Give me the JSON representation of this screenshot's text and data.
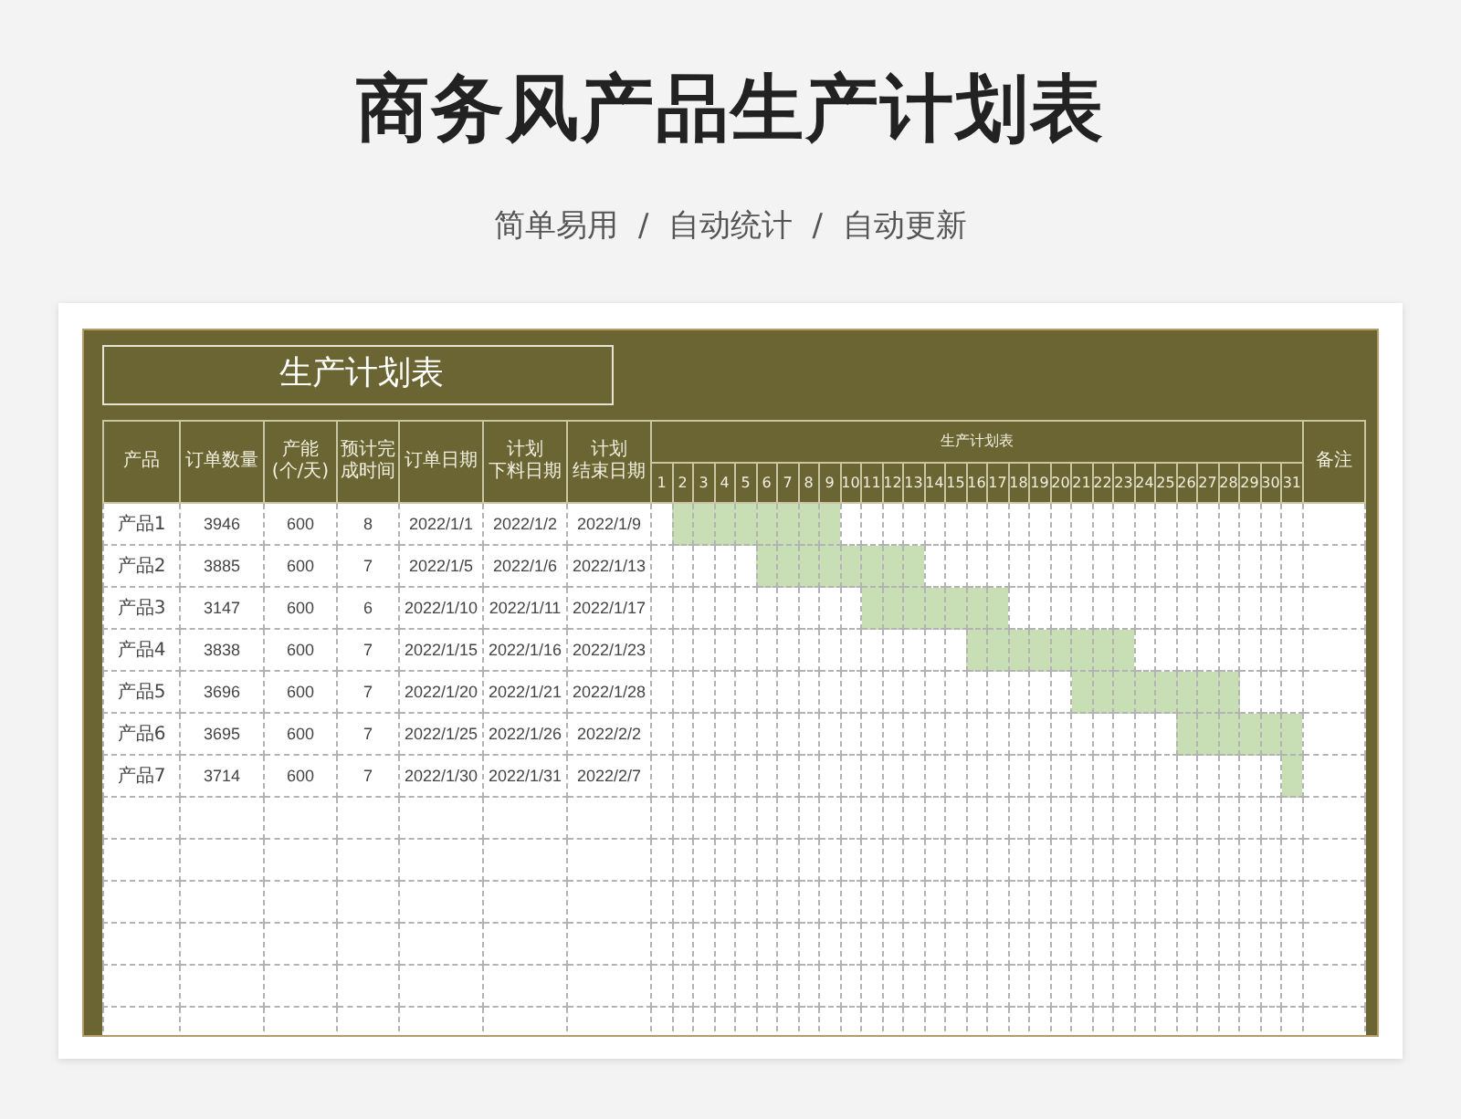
{
  "title": "商务风产品生产计划表",
  "subtitle": "简单易用  /  自动统计  /  自动更新",
  "sheet": {
    "title": "生产计划表",
    "columns": [
      {
        "label": "产品"
      },
      {
        "label": "订单数量"
      },
      {
        "label": "产能",
        "sublabel": "(个/天)"
      },
      {
        "label": "预计完成时间"
      },
      {
        "label": "订单日期"
      },
      {
        "label": "计划",
        "sublabel": "下料日期"
      },
      {
        "label": "计划",
        "sublabel": "结束日期"
      }
    ],
    "gantt_header": "生产计划表",
    "days": [
      "1",
      "2",
      "3",
      "4",
      "5",
      "6",
      "7",
      "8",
      "9",
      "10",
      "11",
      "12",
      "13",
      "14",
      "15",
      "16",
      "17",
      "18",
      "19",
      "20",
      "21",
      "22",
      "23",
      "24",
      "25",
      "26",
      "27",
      "28",
      "29",
      "30",
      "31"
    ],
    "notes_header": "备注",
    "rows": [
      {
        "cells": [
          "产品1",
          "3946",
          "600",
          "8",
          "2022/1/1",
          "2022/1/2",
          "2022/1/9"
        ],
        "gantt": [
          false,
          true,
          true,
          true,
          true,
          true,
          true,
          true,
          true,
          false,
          false,
          false,
          false,
          false,
          false,
          false,
          false,
          false,
          false,
          false,
          false,
          false,
          false,
          false,
          false,
          false,
          false,
          false,
          false,
          false,
          false
        ]
      },
      {
        "cells": [
          "产品2",
          "3885",
          "600",
          "7",
          "2022/1/5",
          "2022/1/6",
          "2022/1/13"
        ],
        "gantt": [
          false,
          false,
          false,
          false,
          false,
          true,
          true,
          true,
          true,
          true,
          true,
          true,
          true,
          false,
          false,
          false,
          false,
          false,
          false,
          false,
          false,
          false,
          false,
          false,
          false,
          false,
          false,
          false,
          false,
          false,
          false
        ]
      },
      {
        "cells": [
          "产品3",
          "3147",
          "600",
          "6",
          "2022/1/10",
          "2022/1/11",
          "2022/1/17"
        ],
        "gantt": [
          false,
          false,
          false,
          false,
          false,
          false,
          false,
          false,
          false,
          false,
          true,
          true,
          true,
          true,
          true,
          true,
          true,
          false,
          false,
          false,
          false,
          false,
          false,
          false,
          false,
          false,
          false,
          false,
          false,
          false,
          false
        ]
      },
      {
        "cells": [
          "产品4",
          "3838",
          "600",
          "7",
          "2022/1/15",
          "2022/1/16",
          "2022/1/23"
        ],
        "gantt": [
          false,
          false,
          false,
          false,
          false,
          false,
          false,
          false,
          false,
          false,
          false,
          false,
          false,
          false,
          false,
          true,
          true,
          true,
          true,
          true,
          true,
          true,
          true,
          false,
          false,
          false,
          false,
          false,
          false,
          false,
          false
        ]
      },
      {
        "cells": [
          "产品5",
          "3696",
          "600",
          "7",
          "2022/1/20",
          "2022/1/21",
          "2022/1/28"
        ],
        "gantt": [
          false,
          false,
          false,
          false,
          false,
          false,
          false,
          false,
          false,
          false,
          false,
          false,
          false,
          false,
          false,
          false,
          false,
          false,
          false,
          false,
          true,
          true,
          true,
          true,
          true,
          true,
          true,
          true,
          false,
          false,
          false
        ]
      },
      {
        "cells": [
          "产品6",
          "3695",
          "600",
          "7",
          "2022/1/25",
          "2022/1/26",
          "2022/2/2"
        ],
        "gantt": [
          false,
          false,
          false,
          false,
          false,
          false,
          false,
          false,
          false,
          false,
          false,
          false,
          false,
          false,
          false,
          false,
          false,
          false,
          false,
          false,
          false,
          false,
          false,
          false,
          false,
          true,
          true,
          true,
          true,
          true,
          true
        ]
      },
      {
        "cells": [
          "产品7",
          "3714",
          "600",
          "7",
          "2022/1/30",
          "2022/1/31",
          "2022/2/7"
        ],
        "gantt": [
          false,
          false,
          false,
          false,
          false,
          false,
          false,
          false,
          false,
          false,
          false,
          false,
          false,
          false,
          false,
          false,
          false,
          false,
          false,
          false,
          false,
          false,
          false,
          false,
          false,
          false,
          false,
          false,
          false,
          false,
          true
        ]
      }
    ]
  }
}
